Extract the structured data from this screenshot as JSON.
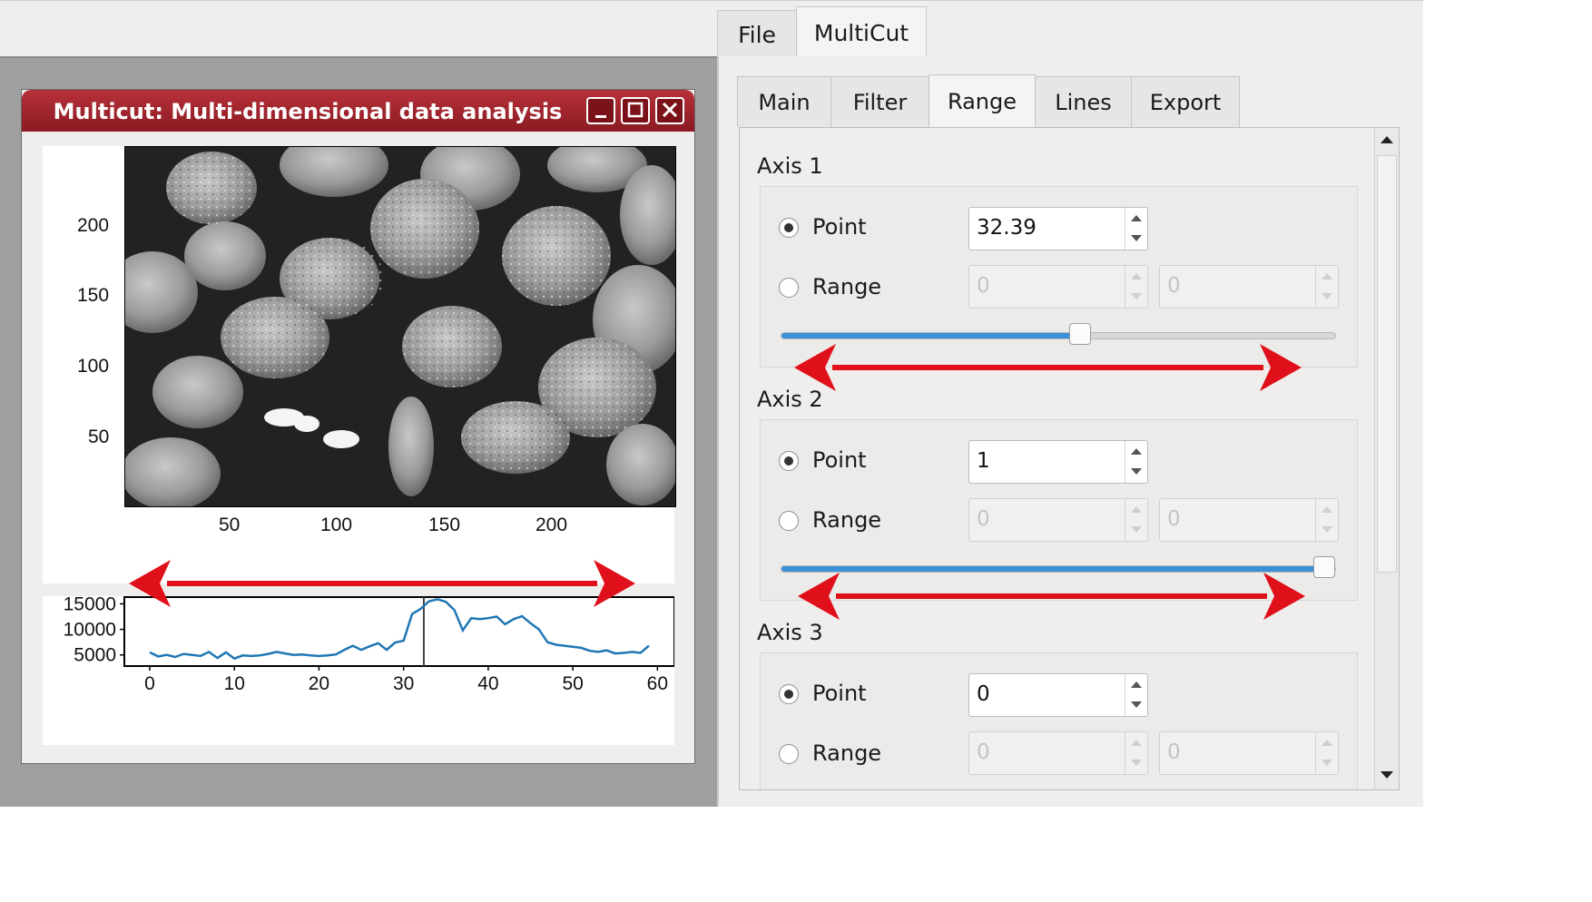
{
  "top_tabs": [
    {
      "label": "File",
      "active": false
    },
    {
      "label": "MultiCut",
      "active": true
    }
  ],
  "window": {
    "title": "Multicut: Multi-dimensional data analysis",
    "controls": [
      "minimize-icon",
      "maximize-icon",
      "close-icon"
    ]
  },
  "image_plot": {
    "x_ticks": [
      "50",
      "100",
      "150",
      "200"
    ],
    "y_ticks": [
      "200",
      "150",
      "100",
      "50"
    ]
  },
  "chart_data": {
    "type": "line",
    "x": [
      0,
      1,
      2,
      3,
      4,
      5,
      6,
      7,
      8,
      9,
      10,
      11,
      12,
      13,
      14,
      15,
      16,
      17,
      18,
      19,
      20,
      21,
      22,
      23,
      24,
      25,
      26,
      27,
      28,
      29,
      30,
      31,
      32,
      33,
      34,
      35,
      36,
      37,
      38,
      39,
      40,
      41,
      42,
      43,
      44,
      45,
      46,
      47,
      48,
      49,
      50,
      51,
      52,
      53,
      54,
      55,
      56,
      57,
      58,
      59
    ],
    "series": [
      {
        "values": [
          5500,
          4700,
          5000,
          4600,
          5200,
          5000,
          4800,
          5600,
          4400,
          5500,
          4300,
          4900,
          4800,
          4900,
          5200,
          5600,
          5300,
          5000,
          5100,
          4900,
          4800,
          4900,
          5100,
          6000,
          6800,
          6000,
          6700,
          7300,
          6000,
          7400,
          7800,
          13000,
          14000,
          15500,
          15900,
          15400,
          13800,
          9800,
          12200,
          12000,
          12200,
          12500,
          11000,
          12000,
          12600,
          11200,
          10000,
          7500,
          7000,
          6800,
          6600,
          6400,
          5800,
          5600,
          5900,
          5300,
          5400,
          5600,
          5400,
          6800
        ]
      }
    ],
    "x_ticks": [
      "0",
      "10",
      "20",
      "30",
      "40",
      "50",
      "60"
    ],
    "y_ticks": [
      "15000",
      "10000",
      "5000"
    ],
    "xlim": [
      -3,
      62
    ],
    "ylim": [
      3000,
      16500
    ],
    "cursor_x": 32.39,
    "line_color": "#1f77b4"
  },
  "inner_tabs": [
    {
      "label": "Main",
      "active": false
    },
    {
      "label": "Filter",
      "active": false
    },
    {
      "label": "Range",
      "active": true
    },
    {
      "label": "Lines",
      "active": false
    },
    {
      "label": "Export",
      "active": false
    }
  ],
  "axes": [
    {
      "label": "Axis 1",
      "point_label": "Point",
      "range_label": "Range",
      "point_value": "32.39",
      "range_min": "0",
      "range_max": "0",
      "selected": "point",
      "slider_fraction": 0.54
    },
    {
      "label": "Axis 2",
      "point_label": "Point",
      "range_label": "Range",
      "point_value": "1",
      "range_min": "0",
      "range_max": "0",
      "selected": "point",
      "slider_fraction": 1.0
    },
    {
      "label": "Axis 3",
      "point_label": "Point",
      "range_label": "Range",
      "point_value": "0",
      "range_min": "0",
      "range_max": "0",
      "selected": "point"
    }
  ],
  "annotation_color": "#e0101a"
}
